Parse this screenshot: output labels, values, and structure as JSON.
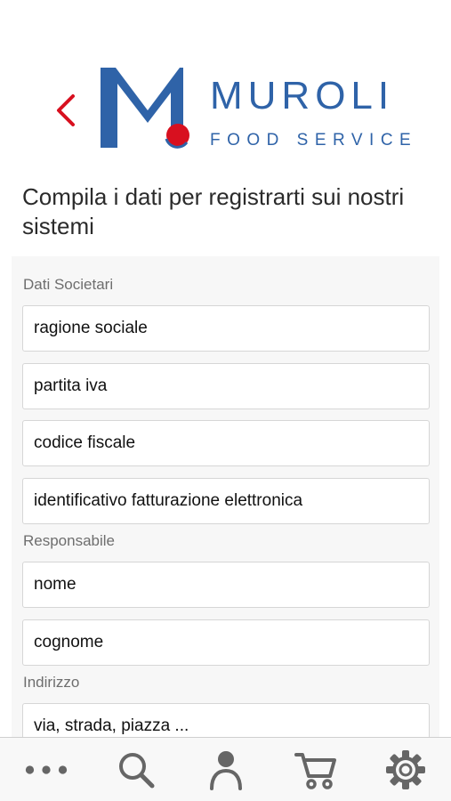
{
  "brand": {
    "name": "MUROLI",
    "subtitle": "FOOD SERVICE",
    "colors": {
      "blue": "#2f63a8",
      "red": "#d8101f"
    }
  },
  "header": {
    "back_icon": "chevron-left-icon"
  },
  "page": {
    "title": "Compila i dati per registrarti sui nostri sistemi"
  },
  "form": {
    "sections": [
      {
        "label": "Dati Societari"
      },
      {
        "label": "Responsabile"
      },
      {
        "label": "Indirizzo"
      }
    ],
    "fields": [
      {
        "placeholder": "ragione sociale"
      },
      {
        "placeholder": "partita iva"
      },
      {
        "placeholder": "codice fiscale"
      },
      {
        "placeholder": "identificativo fatturazione elettronica"
      },
      {
        "placeholder": "nome"
      },
      {
        "placeholder": "cognome"
      },
      {
        "placeholder": "via, strada, piazza ..."
      }
    ]
  },
  "tabbar": {
    "items": [
      {
        "icon": "more-icon"
      },
      {
        "icon": "search-icon"
      },
      {
        "icon": "user-icon"
      },
      {
        "icon": "cart-icon"
      },
      {
        "icon": "gear-icon"
      }
    ]
  }
}
